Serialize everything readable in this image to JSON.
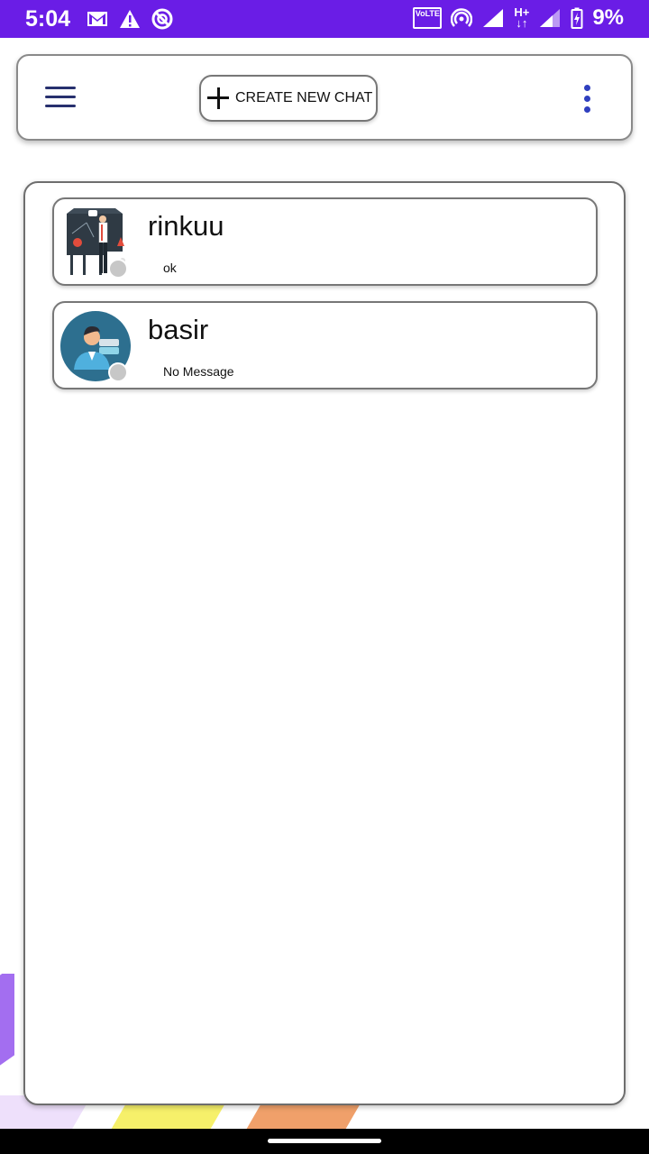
{
  "status_bar": {
    "time": "5:04",
    "left_icons": [
      "gmail-icon",
      "warning-icon",
      "do-not-disturb-icon"
    ],
    "right_icons": [
      "volte-icon",
      "hotspot-icon",
      "signal-icon",
      "h-plus-icon",
      "signal-icon",
      "battery-charging-icon"
    ],
    "volte_label": "VoLTE",
    "network_label": "H+",
    "battery": "9%",
    "background_color": "#6a1de6"
  },
  "header": {
    "create_chat_label": "CREATE NEW CHAT",
    "menu_icon": "hamburger-menu-icon",
    "more_icon": "more-vertical-icon",
    "accent_color": "#2f3fbf"
  },
  "chats": [
    {
      "name": "rinkuu",
      "preview": "ok",
      "avatar": "teacher-illustration-avatar",
      "status": "offline"
    },
    {
      "name": "basir",
      "preview": "No Message",
      "avatar": "person-circle-avatar",
      "status": "offline"
    }
  ],
  "colors": {
    "status_dot": "#c7c7c7",
    "stripe_purple": "#a36ef0",
    "stripe_yellow": "#f6f06a",
    "stripe_orange": "#f0a06a"
  }
}
